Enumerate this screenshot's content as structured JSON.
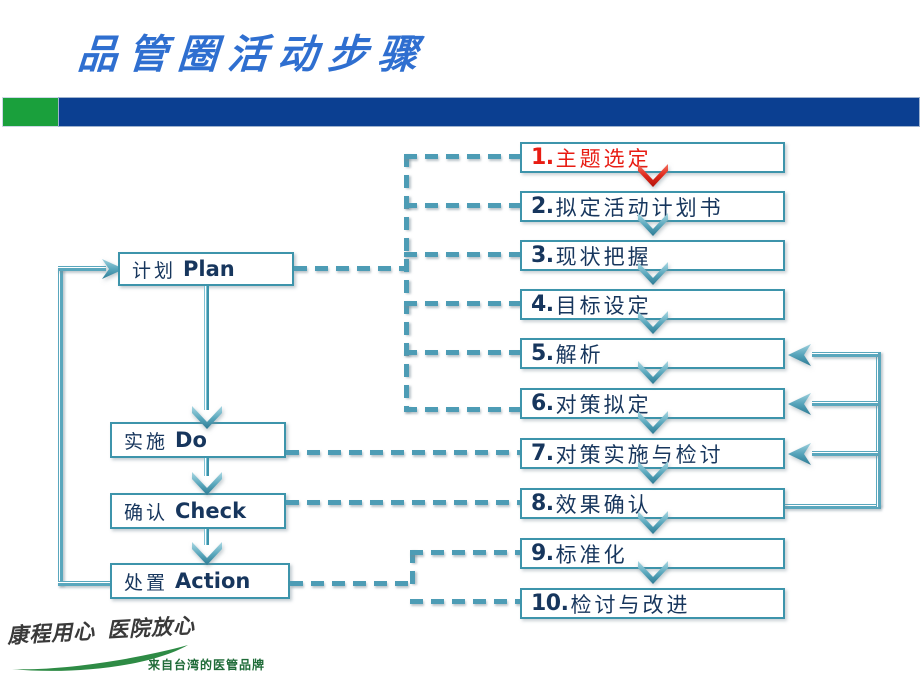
{
  "header": {
    "title": "品管圈活动步骤",
    "accent_blue": "#0b3f91",
    "accent_green": "#1aa03c",
    "title_color": "#2f6fd0"
  },
  "pdca": [
    {
      "cn": "计划",
      "en": "Plan"
    },
    {
      "cn": "实施",
      "en": "Do"
    },
    {
      "cn": "确认",
      "en": "Check"
    },
    {
      "cn": "处置",
      "en": "Action"
    }
  ],
  "steps": [
    {
      "num": "1.",
      "label": "主题选定",
      "color": "#e81c13"
    },
    {
      "num": "2.",
      "label": "拟定活动计划书",
      "color": "#17365d"
    },
    {
      "num": "3.",
      "label": "现状把握",
      "color": "#17365d"
    },
    {
      "num": "4.",
      "label": "目标设定",
      "color": "#17365d"
    },
    {
      "num": "5.",
      "label": "解析",
      "color": "#17365d"
    },
    {
      "num": "6.",
      "label": "对策拟定",
      "color": "#17365d"
    },
    {
      "num": "7.",
      "label": "对策实施与检讨",
      "color": "#17365d"
    },
    {
      "num": "8.",
      "label": "效果确认",
      "color": "#17365d"
    },
    {
      "num": "9.",
      "label": "标准化",
      "color": "#17365d"
    },
    {
      "num": "10.",
      "label": "检讨与改进",
      "color": "#17365d"
    }
  ],
  "footer": {
    "logo_line_a": "康程用心",
    "logo_line_b": "医院放心",
    "tagline": "来自台湾的医管品牌",
    "swoosh_color": "#2e8b45",
    "tagline_color": "#1f6b38"
  },
  "theme": {
    "box_border": "#3d94ab",
    "connector": "#4d9cb5",
    "text_dark": "#17365d",
    "highlight_red": "#e81c13"
  }
}
